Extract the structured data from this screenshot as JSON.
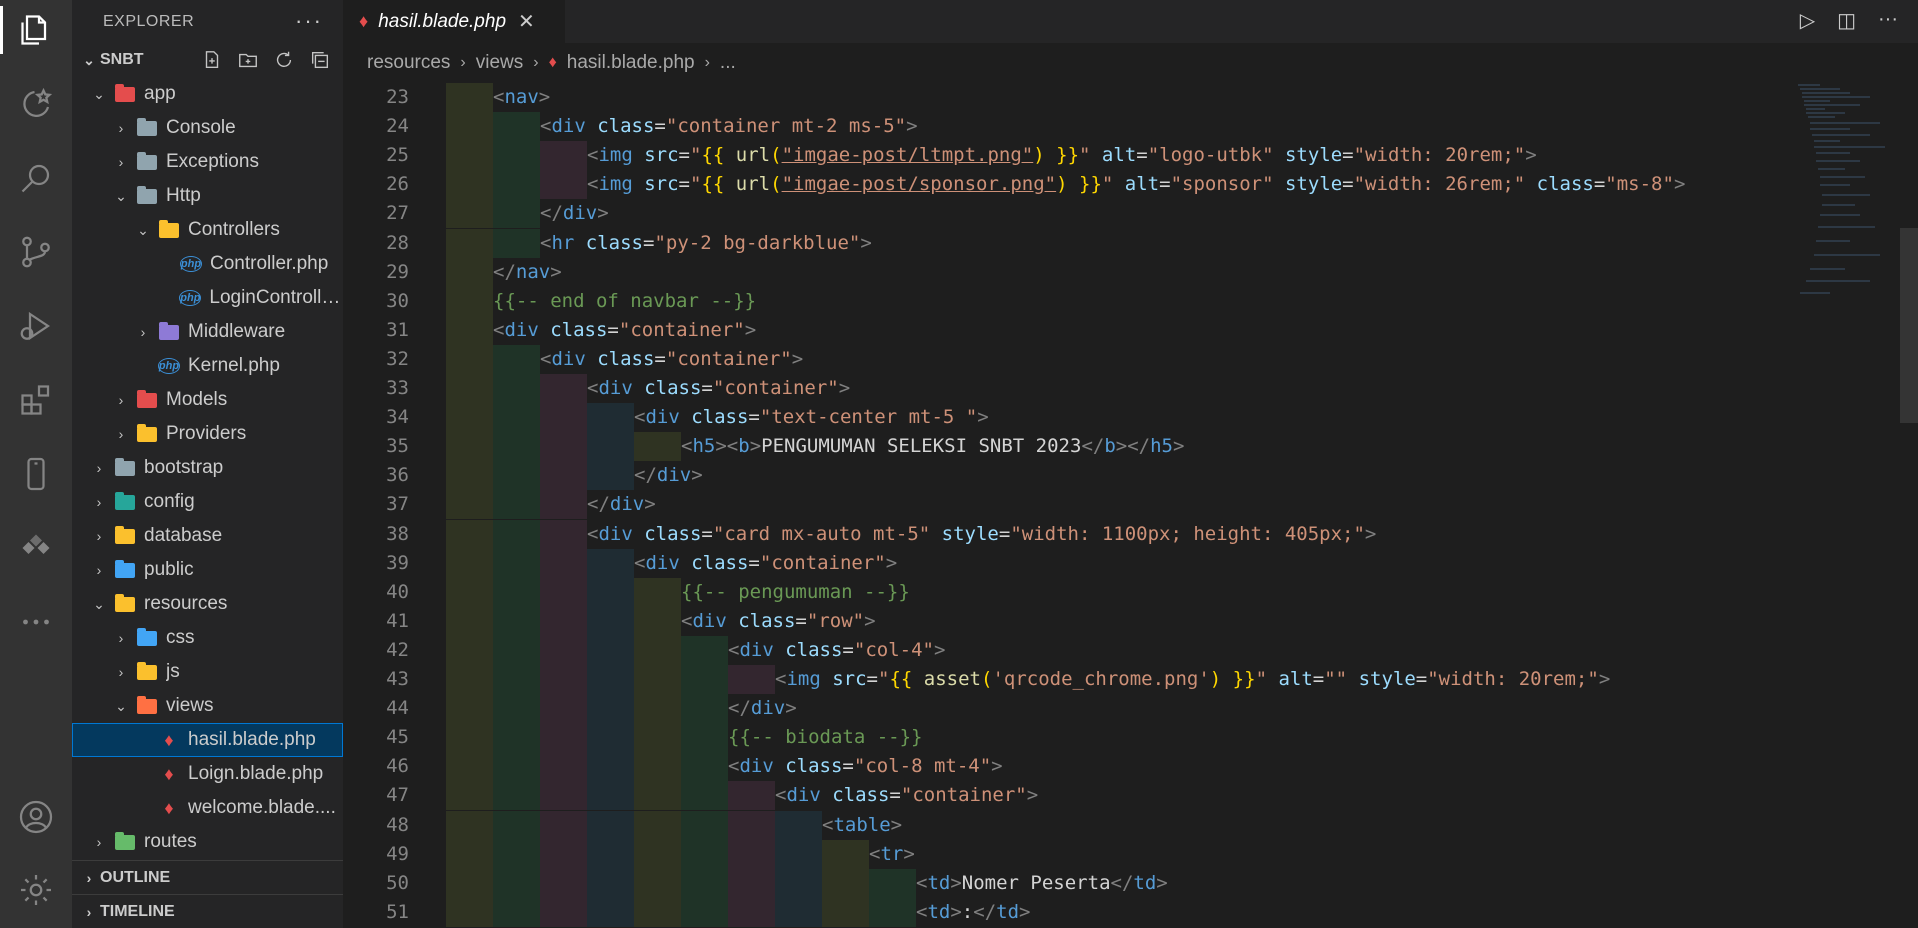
{
  "sidebar": {
    "title": "EXPLORER",
    "more": "···",
    "section": "SNBT",
    "tree": [
      {
        "label": "app",
        "depth": 1,
        "open": true,
        "kind": "folder",
        "color": "#e44d4d"
      },
      {
        "label": "Console",
        "depth": 2,
        "open": false,
        "kind": "folder",
        "color": "#90a4ae"
      },
      {
        "label": "Exceptions",
        "depth": 2,
        "open": false,
        "kind": "folder",
        "color": "#90a4ae"
      },
      {
        "label": "Http",
        "depth": 2,
        "open": true,
        "kind": "folder",
        "color": "#90a4ae"
      },
      {
        "label": "Controllers",
        "depth": 3,
        "open": true,
        "kind": "folder",
        "color": "#fbc02d"
      },
      {
        "label": "Controller.php",
        "depth": 4,
        "kind": "php"
      },
      {
        "label": "LoginControlle...",
        "depth": 4,
        "kind": "php"
      },
      {
        "label": "Middleware",
        "depth": 3,
        "open": false,
        "kind": "folder",
        "color": "#8e7ad6"
      },
      {
        "label": "Kernel.php",
        "depth": 3,
        "kind": "php"
      },
      {
        "label": "Models",
        "depth": 2,
        "open": false,
        "kind": "folder",
        "color": "#e44d4d"
      },
      {
        "label": "Providers",
        "depth": 2,
        "open": false,
        "kind": "folder",
        "color": "#fbc02d"
      },
      {
        "label": "bootstrap",
        "depth": 1,
        "open": false,
        "kind": "folder",
        "color": "#90a4ae"
      },
      {
        "label": "config",
        "depth": 1,
        "open": false,
        "kind": "folder",
        "color": "#26a69a"
      },
      {
        "label": "database",
        "depth": 1,
        "open": false,
        "kind": "folder",
        "color": "#fbc02d"
      },
      {
        "label": "public",
        "depth": 1,
        "open": false,
        "kind": "folder",
        "color": "#42a5f5"
      },
      {
        "label": "resources",
        "depth": 1,
        "open": true,
        "kind": "folder",
        "color": "#fbc02d"
      },
      {
        "label": "css",
        "depth": 2,
        "open": false,
        "kind": "folder",
        "color": "#42a5f5"
      },
      {
        "label": "js",
        "depth": 2,
        "open": false,
        "kind": "folder",
        "color": "#fbc02d"
      },
      {
        "label": "views",
        "depth": 2,
        "open": true,
        "kind": "folder",
        "color": "#ff7043"
      },
      {
        "label": "hasil.blade.php",
        "depth": 3,
        "kind": "blade",
        "selected": true
      },
      {
        "label": "Loign.blade.php",
        "depth": 3,
        "kind": "blade"
      },
      {
        "label": "welcome.blade....",
        "depth": 3,
        "kind": "blade"
      },
      {
        "label": "routes",
        "depth": 1,
        "open": false,
        "kind": "folder",
        "color": "#66bb6a"
      }
    ],
    "outline": "OUTLINE",
    "timeline": "TIMELINE"
  },
  "tab": {
    "label": "hasil.blade.php",
    "close": "✕"
  },
  "breadcrumb": [
    "resources",
    "views",
    "hasil.blade.php",
    "..."
  ],
  "code_lines": [
    {
      "n": "23",
      "indent": 1,
      "tokens": [
        [
          "t-punc",
          "<"
        ],
        [
          "t-tag",
          "nav"
        ],
        [
          "t-punc",
          ">"
        ]
      ]
    },
    {
      "n": "24",
      "indent": 2,
      "tokens": [
        [
          "t-punc",
          "<"
        ],
        [
          "t-tag",
          "div "
        ],
        [
          "t-attr",
          "class"
        ],
        [
          "t-text",
          "="
        ],
        [
          "t-str",
          "\"container mt-2 ms-5\""
        ],
        [
          "t-punc",
          ">"
        ]
      ]
    },
    {
      "n": "25",
      "indent": 3,
      "tokens": [
        [
          "t-punc",
          "<"
        ],
        [
          "t-tag",
          "img "
        ],
        [
          "t-attr",
          "src"
        ],
        [
          "t-text",
          "="
        ],
        [
          "t-str",
          "\""
        ],
        [
          "t-brace",
          "{{ "
        ],
        [
          "t-fn",
          "url"
        ],
        [
          "t-brace",
          "("
        ],
        [
          "t-str t-ul",
          "\"imgae-post/ltmpt.png\""
        ],
        [
          "t-brace",
          ")"
        ],
        [
          "t-brace",
          " }}"
        ],
        [
          "t-str",
          "\""
        ],
        [
          "t-attr",
          " alt"
        ],
        [
          "t-text",
          "="
        ],
        [
          "t-str",
          "\"logo-utbk\""
        ],
        [
          "t-attr",
          " style"
        ],
        [
          "t-text",
          "="
        ],
        [
          "t-str",
          "\"width: 20rem;\""
        ],
        [
          "t-punc",
          ">"
        ]
      ]
    },
    {
      "n": "26",
      "indent": 3,
      "tokens": [
        [
          "t-punc",
          "<"
        ],
        [
          "t-tag",
          "img "
        ],
        [
          "t-attr",
          "src"
        ],
        [
          "t-text",
          "="
        ],
        [
          "t-str",
          "\""
        ],
        [
          "t-brace",
          "{{ "
        ],
        [
          "t-fn",
          "url"
        ],
        [
          "t-brace",
          "("
        ],
        [
          "t-str t-ul",
          "\"imgae-post/sponsor.png\""
        ],
        [
          "t-brace",
          ")"
        ],
        [
          "t-brace",
          " }}"
        ],
        [
          "t-str",
          "\""
        ],
        [
          "t-attr",
          " alt"
        ],
        [
          "t-text",
          "="
        ],
        [
          "t-str",
          "\"sponsor\""
        ],
        [
          "t-attr",
          " style"
        ],
        [
          "t-text",
          "="
        ],
        [
          "t-str",
          "\"width: 26rem;\""
        ],
        [
          "t-attr",
          " class"
        ],
        [
          "t-text",
          "="
        ],
        [
          "t-str",
          "\"ms-8\""
        ],
        [
          "t-punc",
          ">"
        ]
      ]
    },
    {
      "n": "27",
      "indent": 2,
      "tokens": [
        [
          "t-punc",
          "</"
        ],
        [
          "t-tag",
          "div"
        ],
        [
          "t-punc",
          ">"
        ]
      ]
    },
    {
      "n": "28",
      "indent": 2,
      "tokens": [
        [
          "t-punc",
          "<"
        ],
        [
          "t-tag",
          "hr "
        ],
        [
          "t-attr",
          "class"
        ],
        [
          "t-text",
          "="
        ],
        [
          "t-str",
          "\"py-2 bg-darkblue\""
        ],
        [
          "t-punc",
          ">"
        ]
      ]
    },
    {
      "n": "29",
      "indent": 1,
      "tokens": [
        [
          "t-punc",
          "</"
        ],
        [
          "t-tag",
          "nav"
        ],
        [
          "t-punc",
          ">"
        ]
      ]
    },
    {
      "n": "30",
      "indent": 1,
      "tokens": [
        [
          "t-cmt",
          "{{-- end of navbar --}}"
        ]
      ]
    },
    {
      "n": "31",
      "indent": 1,
      "tokens": [
        [
          "t-punc",
          "<"
        ],
        [
          "t-tag",
          "div "
        ],
        [
          "t-attr",
          "class"
        ],
        [
          "t-text",
          "="
        ],
        [
          "t-str",
          "\"container\""
        ],
        [
          "t-punc",
          ">"
        ]
      ]
    },
    {
      "n": "32",
      "indent": 2,
      "tokens": [
        [
          "t-punc",
          "<"
        ],
        [
          "t-tag",
          "div "
        ],
        [
          "t-attr",
          "class"
        ],
        [
          "t-text",
          "="
        ],
        [
          "t-str",
          "\"container\""
        ],
        [
          "t-punc",
          ">"
        ]
      ]
    },
    {
      "n": "33",
      "indent": 3,
      "tokens": [
        [
          "t-punc",
          "<"
        ],
        [
          "t-tag",
          "div "
        ],
        [
          "t-attr",
          "class"
        ],
        [
          "t-text",
          "="
        ],
        [
          "t-str",
          "\"container\""
        ],
        [
          "t-punc",
          ">"
        ]
      ]
    },
    {
      "n": "34",
      "indent": 4,
      "tokens": [
        [
          "t-punc",
          "<"
        ],
        [
          "t-tag",
          "div "
        ],
        [
          "t-attr",
          "class"
        ],
        [
          "t-text",
          "="
        ],
        [
          "t-str",
          "\"text-center mt-5 \""
        ],
        [
          "t-punc",
          ">"
        ]
      ]
    },
    {
      "n": "35",
      "indent": 5,
      "tokens": [
        [
          "t-punc",
          "<"
        ],
        [
          "t-tag",
          "h5"
        ],
        [
          "t-punc",
          "><"
        ],
        [
          "t-tag",
          "b"
        ],
        [
          "t-punc",
          ">"
        ],
        [
          "t-text",
          "PENGUMUMAN SELEKSI SNBT 2023"
        ],
        [
          "t-punc",
          "</"
        ],
        [
          "t-tag",
          "b"
        ],
        [
          "t-punc",
          "></"
        ],
        [
          "t-tag",
          "h5"
        ],
        [
          "t-punc",
          ">"
        ]
      ]
    },
    {
      "n": "36",
      "indent": 4,
      "tokens": [
        [
          "t-punc",
          "</"
        ],
        [
          "t-tag",
          "div"
        ],
        [
          "t-punc",
          ">"
        ]
      ]
    },
    {
      "n": "37",
      "indent": 3,
      "tokens": [
        [
          "t-punc",
          "</"
        ],
        [
          "t-tag",
          "div"
        ],
        [
          "t-punc",
          ">"
        ]
      ]
    },
    {
      "n": "38",
      "indent": 3,
      "tokens": [
        [
          "t-punc",
          "<"
        ],
        [
          "t-tag",
          "div "
        ],
        [
          "t-attr",
          "class"
        ],
        [
          "t-text",
          "="
        ],
        [
          "t-str",
          "\"card mx-auto mt-5\""
        ],
        [
          "t-attr",
          " style"
        ],
        [
          "t-text",
          "="
        ],
        [
          "t-str",
          "\"width: 1100px; height: 405px;\""
        ],
        [
          "t-punc",
          ">"
        ]
      ]
    },
    {
      "n": "39",
      "indent": 4,
      "tokens": [
        [
          "t-punc",
          "<"
        ],
        [
          "t-tag",
          "div "
        ],
        [
          "t-attr",
          "class"
        ],
        [
          "t-text",
          "="
        ],
        [
          "t-str",
          "\"container\""
        ],
        [
          "t-punc",
          ">"
        ]
      ]
    },
    {
      "n": "40",
      "indent": 5,
      "tokens": [
        [
          "t-cmt",
          "{{-- pengumuman --}}"
        ]
      ]
    },
    {
      "n": "41",
      "indent": 5,
      "tokens": [
        [
          "t-punc",
          "<"
        ],
        [
          "t-tag",
          "div "
        ],
        [
          "t-attr",
          "class"
        ],
        [
          "t-text",
          "="
        ],
        [
          "t-str",
          "\"row\""
        ],
        [
          "t-punc",
          ">"
        ]
      ]
    },
    {
      "n": "42",
      "indent": 6,
      "tokens": [
        [
          "t-punc",
          "<"
        ],
        [
          "t-tag",
          "div "
        ],
        [
          "t-attr",
          "class"
        ],
        [
          "t-text",
          "="
        ],
        [
          "t-str",
          "\"col-4\""
        ],
        [
          "t-punc",
          ">"
        ]
      ]
    },
    {
      "n": "43",
      "indent": 7,
      "tokens": [
        [
          "t-punc",
          "<"
        ],
        [
          "t-tag",
          "img "
        ],
        [
          "t-attr",
          "src"
        ],
        [
          "t-text",
          "="
        ],
        [
          "t-str",
          "\""
        ],
        [
          "t-brace",
          "{{ "
        ],
        [
          "t-fn",
          "asset"
        ],
        [
          "t-brace",
          "("
        ],
        [
          "t-str",
          "'qrcode_chrome.png'"
        ],
        [
          "t-brace",
          ")"
        ],
        [
          "t-brace",
          " }}"
        ],
        [
          "t-str",
          "\""
        ],
        [
          "t-attr",
          " alt"
        ],
        [
          "t-text",
          "="
        ],
        [
          "t-str",
          "\"\""
        ],
        [
          "t-attr",
          " style"
        ],
        [
          "t-text",
          "="
        ],
        [
          "t-str",
          "\"width: 20rem;\""
        ],
        [
          "t-punc",
          ">"
        ]
      ]
    },
    {
      "n": "44",
      "indent": 6,
      "tokens": [
        [
          "t-punc",
          "</"
        ],
        [
          "t-tag",
          "div"
        ],
        [
          "t-punc",
          ">"
        ]
      ]
    },
    {
      "n": "45",
      "indent": 6,
      "tokens": [
        [
          "t-cmt",
          "{{-- biodata --}}"
        ]
      ]
    },
    {
      "n": "46",
      "indent": 6,
      "tokens": [
        [
          "t-punc",
          "<"
        ],
        [
          "t-tag",
          "div "
        ],
        [
          "t-attr",
          "class"
        ],
        [
          "t-text",
          "="
        ],
        [
          "t-str",
          "\"col-8 mt-4\""
        ],
        [
          "t-punc",
          ">"
        ]
      ]
    },
    {
      "n": "47",
      "indent": 7,
      "tokens": [
        [
          "t-punc",
          "<"
        ],
        [
          "t-tag",
          "div "
        ],
        [
          "t-attr",
          "class"
        ],
        [
          "t-text",
          "="
        ],
        [
          "t-str",
          "\"container\""
        ],
        [
          "t-punc",
          ">"
        ]
      ]
    },
    {
      "n": "48",
      "indent": 8,
      "tokens": [
        [
          "t-punc",
          "<"
        ],
        [
          "t-tag",
          "table"
        ],
        [
          "t-punc",
          ">"
        ]
      ]
    },
    {
      "n": "49",
      "indent": 9,
      "tokens": [
        [
          "t-punc",
          "<"
        ],
        [
          "t-tag",
          "tr"
        ],
        [
          "t-punc",
          ">"
        ]
      ]
    },
    {
      "n": "50",
      "indent": 10,
      "tokens": [
        [
          "t-punc",
          "<"
        ],
        [
          "t-tag",
          "td"
        ],
        [
          "t-punc",
          ">"
        ],
        [
          "t-text",
          "Nomer Peserta"
        ],
        [
          "t-punc",
          "</"
        ],
        [
          "t-tag",
          "td"
        ],
        [
          "t-punc",
          ">"
        ]
      ]
    },
    {
      "n": "51",
      "indent": 10,
      "tokens": [
        [
          "t-punc",
          "<"
        ],
        [
          "t-tag",
          "td"
        ],
        [
          "t-punc",
          ">"
        ],
        [
          "t-text",
          ":"
        ],
        [
          "t-punc",
          "</"
        ],
        [
          "t-tag",
          "td"
        ],
        [
          "t-punc",
          ">"
        ]
      ]
    }
  ],
  "guide_colors": [
    "#2f3322",
    "#1f3327",
    "#33262f",
    "#1f2c33",
    "#2f3322",
    "#1f3327",
    "#33262f",
    "#1f2c33",
    "#2f3322",
    "#1f3327"
  ]
}
